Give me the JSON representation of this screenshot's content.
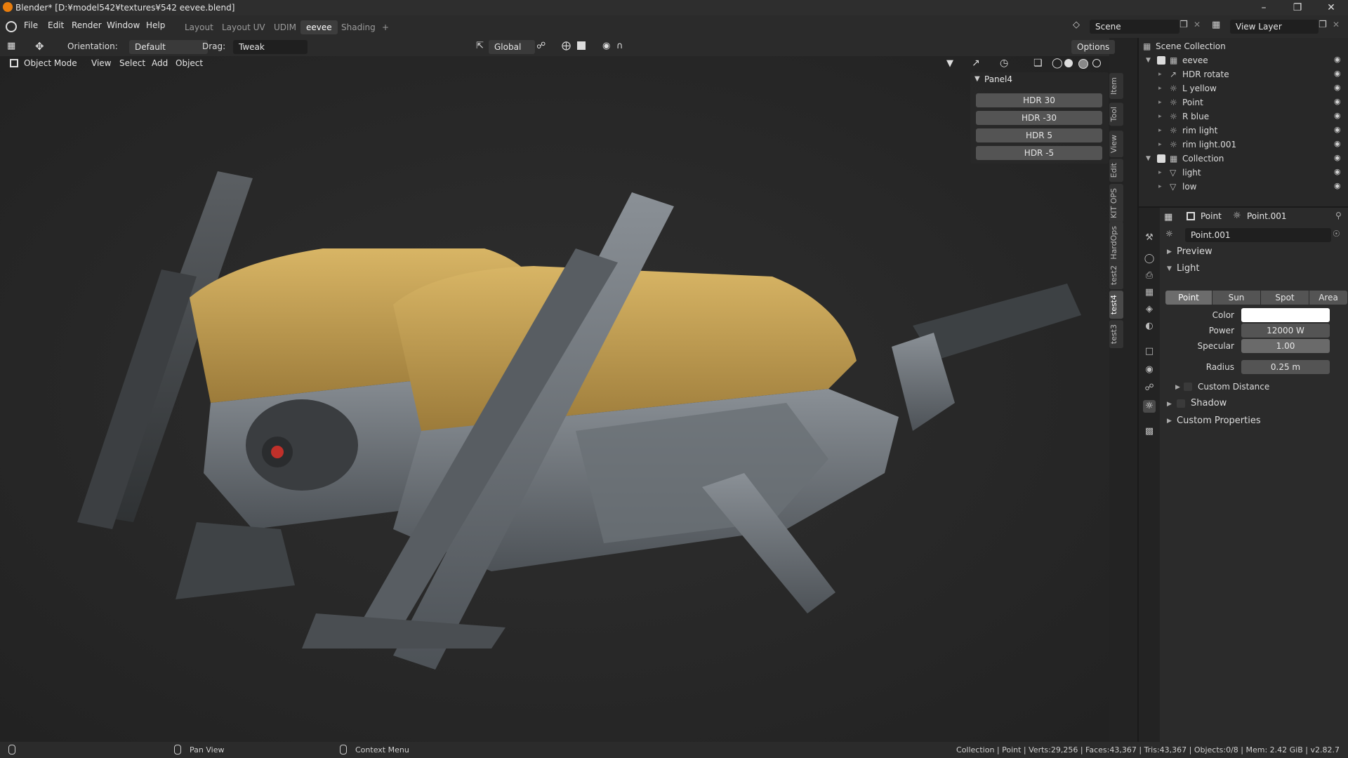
{
  "window": {
    "title": "Blender* [D:¥model542¥textures¥542 eevee.blend]",
    "min": "–",
    "max": "❐",
    "close": "✕"
  },
  "menu": [
    "File",
    "Edit",
    "Render",
    "Window",
    "Help"
  ],
  "workspaces": [
    {
      "label": "Layout",
      "active": false
    },
    {
      "label": "Layout UV",
      "active": false
    },
    {
      "label": "UDIM",
      "active": false
    },
    {
      "label": "eevee",
      "active": true
    },
    {
      "label": "Shading",
      "active": false
    }
  ],
  "workspace_add": "+",
  "scene": {
    "label": "Scene",
    "view_layer": "View Layer"
  },
  "tool_header": {
    "orientation_label": "Orientation:",
    "orientation_value": "Default",
    "drag_label": "Drag:",
    "drag_value": "Tweak",
    "transform_space": "Global",
    "options": "Options"
  },
  "view_header": {
    "mode": "Object Mode",
    "items": [
      "View",
      "Select",
      "Add",
      "Object"
    ]
  },
  "npanel": {
    "title": "Panel4",
    "buttons": [
      "HDR 30",
      "HDR -30",
      "HDR 5",
      "HDR -5"
    ]
  },
  "vertical_tabs": [
    "Item",
    "Tool",
    "View",
    "Edit",
    "KIT OPS",
    "HardOps",
    "test2",
    "test4",
    "test3"
  ],
  "outliner": {
    "root": "Scene Collection",
    "rows": [
      {
        "label": "eevee",
        "indent": 1,
        "type": "collection"
      },
      {
        "label": "HDR rotate",
        "indent": 2,
        "type": "empty"
      },
      {
        "label": "L yellow",
        "indent": 2,
        "type": "light"
      },
      {
        "label": "Point",
        "indent": 2,
        "type": "light"
      },
      {
        "label": "R blue",
        "indent": 2,
        "type": "light"
      },
      {
        "label": "rim light",
        "indent": 2,
        "type": "light"
      },
      {
        "label": "rim light.001",
        "indent": 2,
        "type": "light"
      },
      {
        "label": "Collection",
        "indent": 1,
        "type": "collection"
      },
      {
        "label": "light",
        "indent": 2,
        "type": "mesh"
      },
      {
        "label": "low",
        "indent": 2,
        "type": "mesh"
      }
    ]
  },
  "properties": {
    "object": "Point",
    "data": "Point.001",
    "datablock": "Point.001",
    "sections": {
      "preview": "Preview",
      "light": "Light",
      "shadow": "Shadow",
      "custom_props": "Custom Properties"
    },
    "light_types": [
      {
        "label": "Point",
        "active": true
      },
      {
        "label": "Sun",
        "active": false
      },
      {
        "label": "Spot",
        "active": false
      },
      {
        "label": "Area",
        "active": false
      }
    ],
    "fields": {
      "color_label": "Color",
      "power_label": "Power",
      "power_value": "12000 W",
      "specular_label": "Specular",
      "specular_value": "1.00",
      "radius_label": "Radius",
      "radius_value": "0.25 m"
    },
    "custom_distance": "Custom Distance"
  },
  "statusbar": {
    "pan": "Pan View",
    "context": "Context Menu",
    "info": "Collection | Point | Verts:29,256 | Faces:43,367 | Tris:43,367 | Objects:0/8 | Mem: 2.42 GiB | v2.82.7"
  },
  "colors": {
    "accent": "#e87d0d",
    "yellow_panel": "#c9a54e",
    "metal": "#6c7278"
  }
}
